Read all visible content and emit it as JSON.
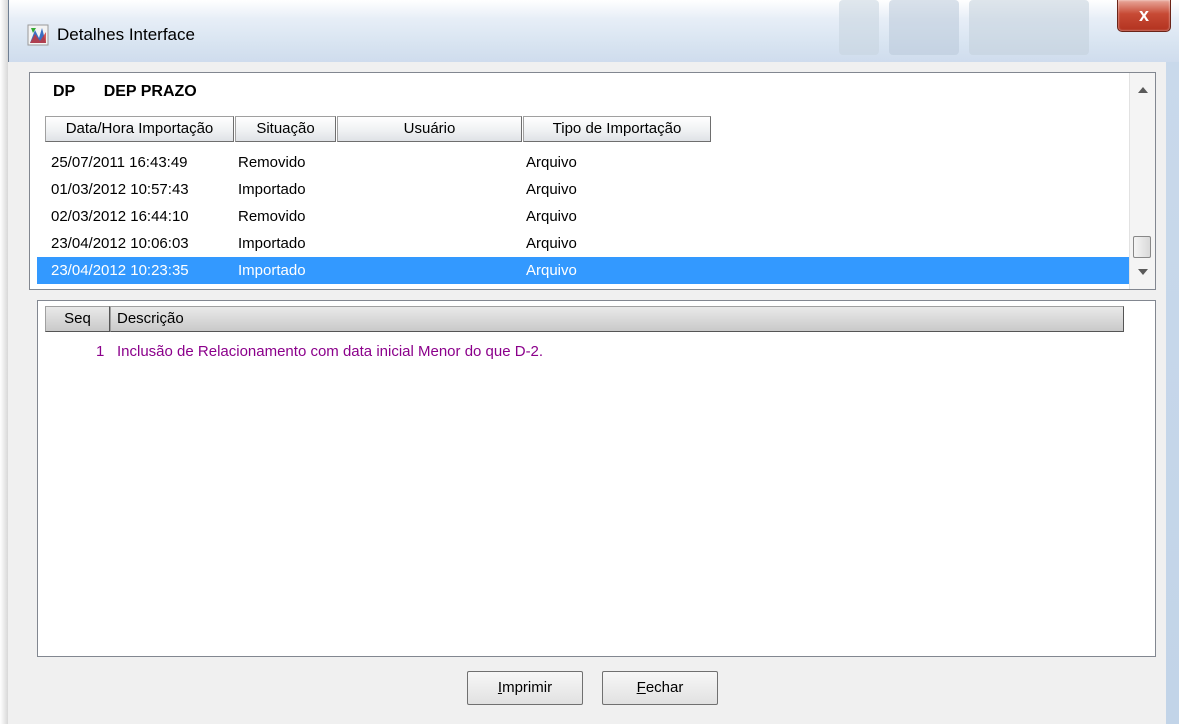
{
  "window": {
    "title": "Detalhes Interface",
    "close_label": "x"
  },
  "group": {
    "code": "DP",
    "name": "DEP PRAZO"
  },
  "imports_table": {
    "columns": [
      "Data/Hora Importação",
      "Situação",
      "Usuário",
      "Tipo de Importação"
    ],
    "rows": [
      {
        "datetime": "25/07/2011 16:43:49",
        "status": "Removido",
        "user": "",
        "type": "Arquivo"
      },
      {
        "datetime": "01/03/2012 10:57:43",
        "status": "Importado",
        "user": "",
        "type": "Arquivo"
      },
      {
        "datetime": "02/03/2012 16:44:10",
        "status": "Removido",
        "user": "",
        "type": "Arquivo"
      },
      {
        "datetime": "23/04/2012 10:06:03",
        "status": "Importado",
        "user": "",
        "type": "Arquivo"
      },
      {
        "datetime": "23/04/2012 10:23:35",
        "status": "Importado",
        "user": "",
        "type": "Arquivo",
        "selected": true
      }
    ]
  },
  "details_table": {
    "columns": [
      "Seq",
      "Descrição"
    ],
    "rows": [
      {
        "seq": "1",
        "description": "Inclusão de Relacionamento com data inicial Menor do que D-2."
      }
    ]
  },
  "buttons": {
    "print_mnemonic": "I",
    "print_rest": "mprimir",
    "close_mnemonic": "F",
    "close_rest": "echar"
  },
  "colors": {
    "selection": "#3399ff",
    "message_text": "#8b008b"
  }
}
